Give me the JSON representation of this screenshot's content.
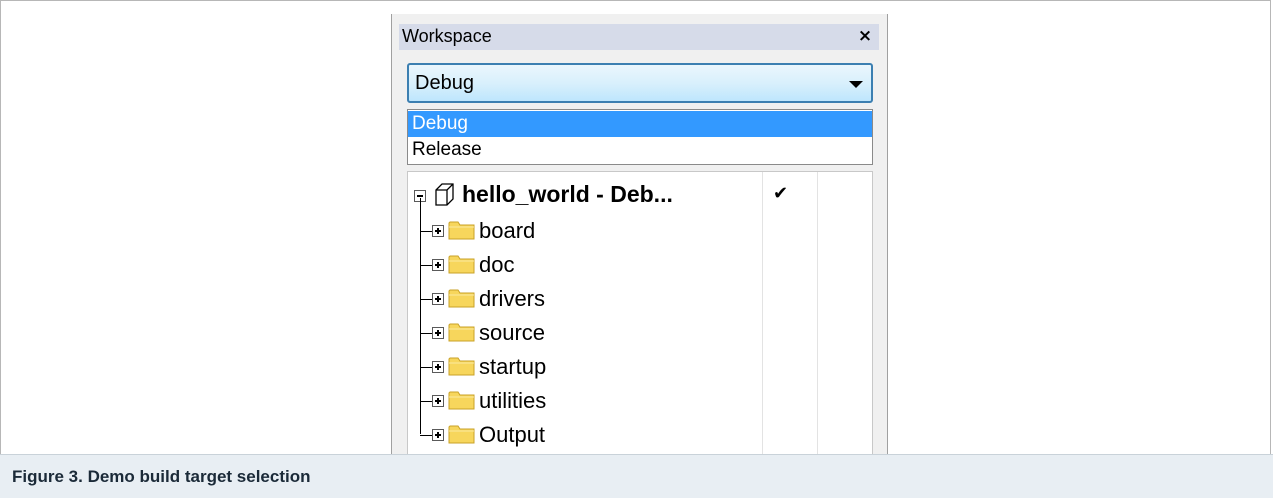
{
  "workspace": {
    "title": "Workspace",
    "close_glyph": "×",
    "build_target": {
      "selected": "Debug",
      "options": [
        "Debug",
        "Release"
      ]
    },
    "project": {
      "name": "hello_world - Deb...",
      "check": "✔",
      "icon": "project-cube-icon"
    },
    "folders": [
      {
        "label": "board",
        "icon": "folder-icon"
      },
      {
        "label": "doc",
        "icon": "folder-icon"
      },
      {
        "label": "drivers",
        "icon": "folder-icon"
      },
      {
        "label": "source",
        "icon": "folder-icon"
      },
      {
        "label": "startup",
        "icon": "folder-icon"
      },
      {
        "label": "utilities",
        "icon": "folder-icon"
      },
      {
        "label": "Output",
        "icon": "folder-icon"
      }
    ]
  },
  "caption": "Figure 3.  Demo build target selection",
  "colors": {
    "selection": "#3399ff",
    "caption_bg": "#e8eef3",
    "titlebar_bg": "#d6dbe9",
    "folder_yellow": "#f7d65c"
  }
}
